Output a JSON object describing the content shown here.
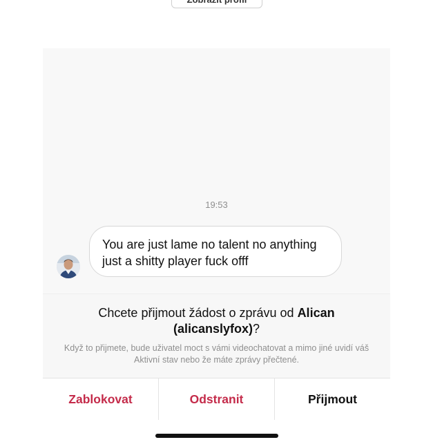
{
  "header": {
    "view_profile_label": "Zobrazit profil"
  },
  "chat": {
    "timestamp": "19:53",
    "message": {
      "line1": "You are just lame no talent no anything",
      "line2": "just a shitty player fuck offf"
    }
  },
  "request": {
    "title_prefix": "Chcete přijmout žádost o zprávu od ",
    "sender_name": "Alican",
    "sender_username": "(alicanslyfox)",
    "title_suffix": "?",
    "description": "Když to přijmete, bude uživatel moct s vámi videochatovat a mimo jiné uvidí váš Aktivní stav nebo že máte zprávy přečtené."
  },
  "actions": {
    "block_label": "Zablokovat",
    "delete_label": "Odstranit",
    "accept_label": "Přijmout"
  },
  "colors": {
    "danger": "#c42b4a",
    "text": "#111111",
    "muted": "#8e8e8e",
    "panel": "#f7f7f7"
  },
  "icons": {
    "sender_avatar": "avatar-icon"
  }
}
